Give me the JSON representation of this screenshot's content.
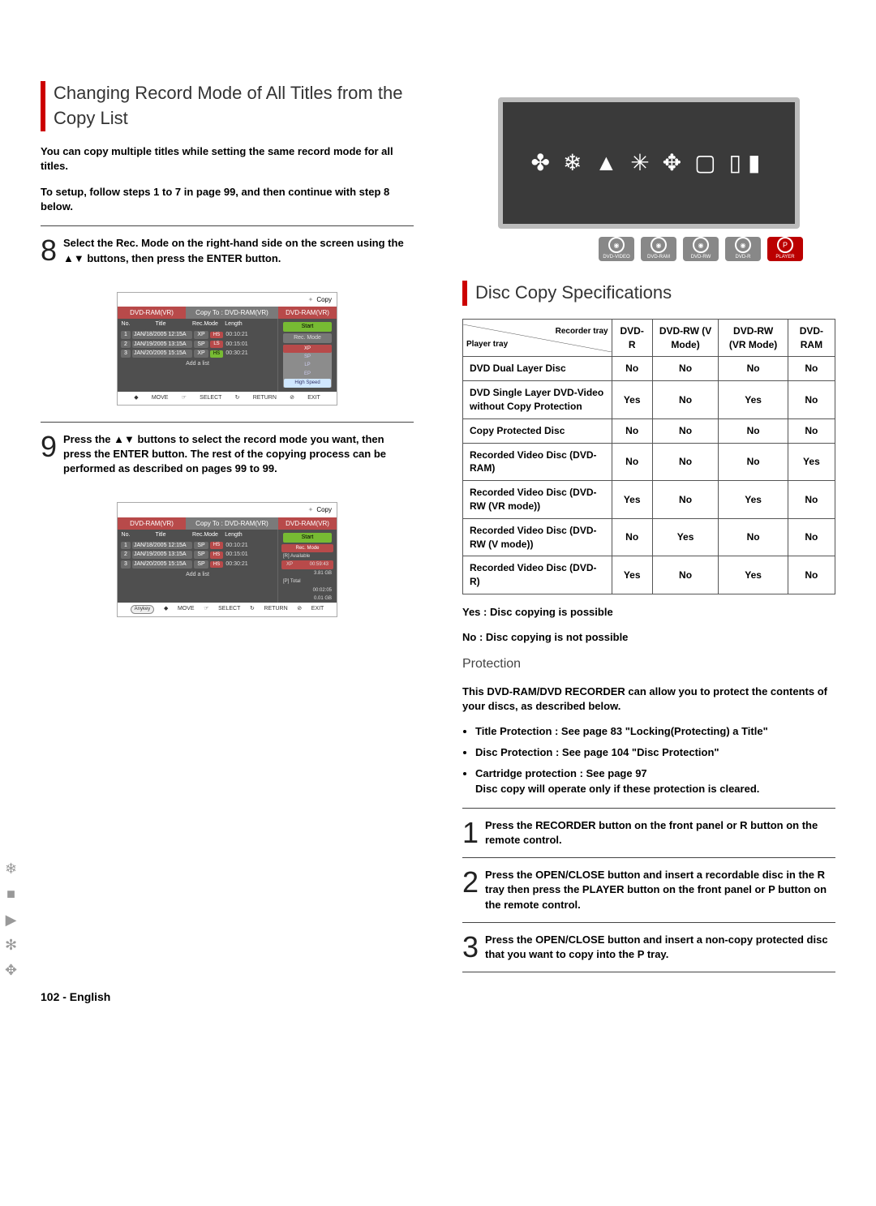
{
  "left": {
    "heading": "Changing Record Mode of All Titles from the Copy List",
    "para1": "You can copy multiple titles while setting the same record mode for all titles.",
    "para2": "To setup, follow steps 1 to 7 in page 99, and then continue with step 8 below.",
    "step8": "Select the Rec. Mode on the right-hand side on the screen using the ▲▼ buttons, then press the ENTER button.",
    "screen1": {
      "copy_label": "Copy",
      "headers": [
        "No.",
        "Title",
        "Rec.Mode",
        "Length"
      ],
      "seg1": "DVD-RAM(VR)",
      "seg2": "Copy To : DVD-RAM(VR)",
      "seg3": "DVD-RAM(VR)",
      "rows": [
        {
          "no": "1",
          "title": "JAN/18/2005 12:15A",
          "mode": "XP",
          "tag": "HS",
          "len": "00:10:21"
        },
        {
          "no": "2",
          "title": "JAN/19/2005 13:15A",
          "mode": "SP",
          "tag": "LS",
          "len": "00:15:01"
        },
        {
          "no": "3",
          "title": "JAN/20/2005 15:15A",
          "mode": "XP",
          "tag": "HS",
          "len": "00:30:21"
        }
      ],
      "add": "Add a list",
      "right": {
        "start": "Start",
        "recmode": "Rec. Mode",
        "modes": [
          "XP",
          "SP",
          "LP",
          "EP",
          "High Speed"
        ]
      },
      "footer": [
        "MOVE",
        "SELECT",
        "RETURN",
        "EXIT"
      ]
    },
    "step9": "Press the ▲▼ buttons to select the record mode you want, then press the ENTER button. The rest of the copying process can be performed as described on pages 99 to 99.",
    "screen2": {
      "copy_label": "Copy",
      "headers": [
        "No.",
        "Title",
        "Rec.Mode",
        "Length"
      ],
      "seg1": "DVD-RAM(VR)",
      "seg2": "Copy To : DVD-RAM(VR)",
      "seg3": "DVD-RAM(VR)",
      "rows": [
        {
          "no": "1",
          "title": "JAN/18/2005 12:15A",
          "mode": "SP",
          "tag": "HS",
          "len": "00:10:21"
        },
        {
          "no": "2",
          "title": "JAN/19/2005 13:15A",
          "mode": "SP",
          "tag": "HS",
          "len": "00:15:01"
        },
        {
          "no": "3",
          "title": "JAN/20/2005 15:15A",
          "mode": "SP",
          "tag": "HS",
          "len": "00:30:21"
        }
      ],
      "add": "Add a list",
      "right": {
        "start": "Start",
        "recmode": "Rec. Mode",
        "avail_label": "[R] Available",
        "lines": [
          {
            "l": "XP",
            "r": "00:59:43"
          },
          {
            "l": "",
            "r": "3.81 GB"
          },
          {
            "l": "[P] Total",
            "r": ""
          },
          {
            "l": "",
            "r": "00:02:05"
          },
          {
            "l": "",
            "r": "0.01 GB"
          }
        ]
      },
      "footer": [
        "Anykey",
        "MOVE",
        "SELECT",
        "RETURN",
        "EXIT"
      ]
    }
  },
  "right": {
    "discs": [
      "DVD-VIDEO",
      "DVD-RAM",
      "DVD-RW",
      "DVD-R",
      "PLAYER"
    ],
    "spec_heading": "Disc Copy Specifications",
    "table": {
      "diag_top": "Recorder tray",
      "diag_bot": "Player tray",
      "cols": [
        "DVD-R",
        "DVD-RW (V Mode)",
        "DVD-RW (VR Mode)",
        "DVD-RAM"
      ],
      "rows": [
        {
          "label": "DVD Dual Layer Disc",
          "v": [
            "No",
            "No",
            "No",
            "No"
          ]
        },
        {
          "label": "DVD Single Layer DVD-Video without Copy Protection",
          "v": [
            "Yes",
            "No",
            "Yes",
            "No"
          ]
        },
        {
          "label": "Copy Protected Disc",
          "v": [
            "No",
            "No",
            "No",
            "No"
          ]
        },
        {
          "label": "Recorded Video Disc (DVD-RAM)",
          "v": [
            "No",
            "No",
            "No",
            "Yes"
          ]
        },
        {
          "label": "Recorded Video Disc (DVD-RW (VR mode))",
          "v": [
            "Yes",
            "No",
            "Yes",
            "No"
          ]
        },
        {
          "label": "Recorded Video Disc (DVD-RW (V mode))",
          "v": [
            "No",
            "Yes",
            "No",
            "No"
          ]
        },
        {
          "label": "Recorded Video Disc (DVD-R)",
          "v": [
            "Yes",
            "No",
            "Yes",
            "No"
          ]
        }
      ]
    },
    "yes_note": "Yes : Disc copying is possible",
    "no_note": "No : Disc copying is not possible",
    "prot_head": "Protection",
    "prot_intro": "This DVD-RAM/DVD RECORDER can allow you to protect the contents of your discs, as described below.",
    "prot_items": [
      "Title Protection : See page 83 \"Locking(Protecting) a Title\"",
      "Disc Protection : See page 104 \"Disc Protection\"",
      "Cartridge protection : See page 97\nDisc copy will operate only if these protection is cleared."
    ],
    "step1": "Press the RECORDER button on the front panel or R button on the remote control.",
    "step2": "Press the OPEN/CLOSE button and insert a recordable disc in the R tray then press the PLAYER button on the front panel or P button on the remote control.",
    "step3": "Press the OPEN/CLOSE button and insert a non-copy protected disc that you want to copy into the P tray."
  },
  "page_number": "102 - English"
}
